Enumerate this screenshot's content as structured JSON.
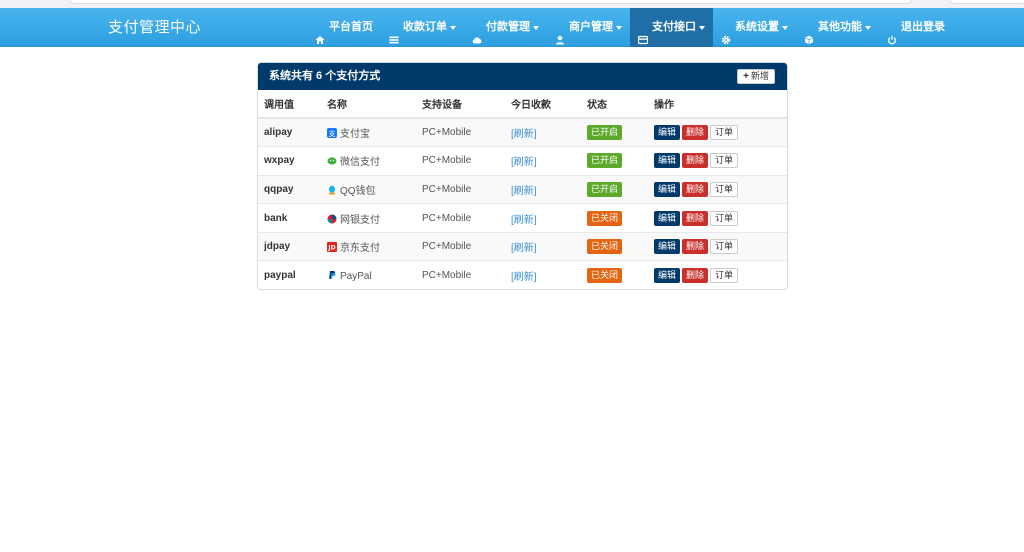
{
  "brand": "支付管理中心",
  "nav": [
    {
      "label": "平台首页",
      "icon": "home-icon",
      "dropdown": false,
      "active": false
    },
    {
      "label": "收款订单",
      "icon": "list-icon",
      "dropdown": true,
      "active": false
    },
    {
      "label": "付款管理",
      "icon": "cloud-icon",
      "dropdown": true,
      "active": false
    },
    {
      "label": "商户管理",
      "icon": "user-icon",
      "dropdown": true,
      "active": false
    },
    {
      "label": "支付接口",
      "icon": "credit-card-icon",
      "dropdown": true,
      "active": true
    },
    {
      "label": "系统设置",
      "icon": "gear-icon",
      "dropdown": true,
      "active": false
    },
    {
      "label": "其他功能",
      "icon": "cube-icon",
      "dropdown": true,
      "active": false
    },
    {
      "label": "退出登录",
      "icon": "power-icon",
      "dropdown": false,
      "active": false
    }
  ],
  "panel": {
    "title": "系统共有 6 个支付方式",
    "add_label": "新增"
  },
  "table": {
    "headers": [
      "调用值",
      "名称",
      "支持设备",
      "今日收款",
      "状态",
      "操作"
    ],
    "rows": [
      {
        "code": "alipay",
        "name": "支付宝",
        "icon": "alipay-icon",
        "icon_color": "#1678ff",
        "device": "PC+Mobile",
        "today": "[刷新]",
        "status": "已开启",
        "enabled": true
      },
      {
        "code": "wxpay",
        "name": "微信支付",
        "icon": "wechat-icon",
        "icon_color": "#3cb034",
        "device": "PC+Mobile",
        "today": "[刷新]",
        "status": "已开启",
        "enabled": true
      },
      {
        "code": "qqpay",
        "name": "QQ钱包",
        "icon": "qq-icon",
        "icon_color": "#12b7f5",
        "device": "PC+Mobile",
        "today": "[刷新]",
        "status": "已开启",
        "enabled": true
      },
      {
        "code": "bank",
        "name": "网银支付",
        "icon": "unionpay-icon",
        "icon_color": "#e21836",
        "device": "PC+Mobile",
        "today": "[刷新]",
        "status": "已关闭",
        "enabled": false
      },
      {
        "code": "jdpay",
        "name": "京东支付",
        "icon": "jd-icon",
        "icon_color": "#e1251b",
        "device": "PC+Mobile",
        "today": "[刷新]",
        "status": "已关闭",
        "enabled": false
      },
      {
        "code": "paypal",
        "name": "PayPal",
        "icon": "paypal-icon",
        "icon_color": "#003087",
        "device": "PC+Mobile",
        "today": "[刷新]",
        "status": "已关闭",
        "enabled": false
      }
    ],
    "actions": {
      "edit": "编辑",
      "delete": "删除",
      "orders": "订单"
    }
  }
}
